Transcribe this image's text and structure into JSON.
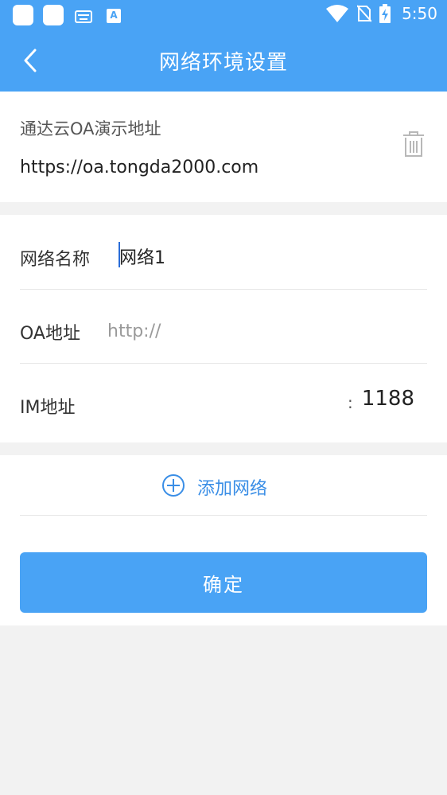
{
  "status_bar": {
    "time": "5:50"
  },
  "header": {
    "title": "网络环境设置",
    "back_icon": "chevron-left-icon"
  },
  "current_network": {
    "name": "通达云OA演示地址",
    "url": "https://oa.tongda2000.com",
    "delete_icon": "trash-icon"
  },
  "form": {
    "network_name": {
      "label": "网络名称",
      "value": "网络1"
    },
    "oa_address": {
      "label": "OA地址",
      "placeholder": "http://"
    },
    "im_address": {
      "label": "IM地址",
      "separator": ":",
      "port": "1188"
    }
  },
  "add_network": {
    "label": "添加网络",
    "icon": "plus-circle-icon"
  },
  "confirm_button": {
    "label": "确定"
  },
  "colors": {
    "primary": "#49a3f5",
    "link": "#3a8ee6",
    "background": "#f2f2f2"
  }
}
